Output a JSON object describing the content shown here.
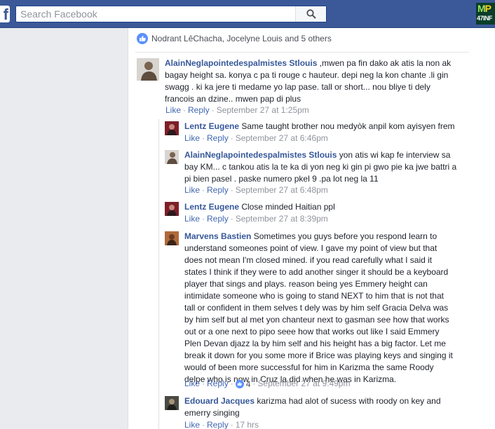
{
  "topbar": {
    "logo_letter": "f",
    "search_placeholder": "Search Facebook",
    "corner_logo_line1_a": "M",
    "corner_logo_line1_b": "P",
    "corner_logo_line2": "47INF"
  },
  "post": {
    "reactions_text": "Nodrant LêChacha, Jocelyne Louis and 5 others"
  },
  "comments": [
    {
      "author": "AlainNeglapointedespalmistes Stlouis",
      "text": " ,mwen pa fin dako ak atis la non ak bagay height sa. konya c pa ti rouge c hauteur. depi neg la kon chante .li gin swagg . ki ka jere ti medame yo lap pase. tall or short... nou bliye ti dely francois an dzine.. mwen pap di plus",
      "like": "Like",
      "reply": "Reply",
      "time": "September 27 at 1:25pm"
    }
  ],
  "replies": [
    {
      "author": "Lentz Eugene",
      "text": " Same taught brother nou medyòk anpil kom ayisyen frem",
      "like": "Like",
      "reply": "Reply",
      "time": "September 27 at 6:46pm"
    },
    {
      "author": "AlainNeglapointedespalmistes Stlouis",
      "text": " yon atis wi kap fe interview sa bay KM... c tankou atis la te ka di yon neg ki gin pi gwo pie ka jwe battri a pi bien pasel . paske numero pkel 9 .pa lot neg la 11",
      "like": "Like",
      "reply": "Reply",
      "time": "September 27 at 6:48pm"
    },
    {
      "author": "Lentz Eugene",
      "text": " Close minded Haitian ppl",
      "like": "Like",
      "reply": "Reply",
      "time": "September 27 at 8:39pm"
    },
    {
      "author": "Marvens Bastien",
      "text": " Sometimes you guys before you respond learn to understand someones point of view. I gave my point of view but that does not mean I'm closed mined. if you read carefully what I said it states I think if they were to add another singer it should be a keyboard player that sings and plays. reason being yes Emmery height can intimidate someone who is going to stand NEXT to him that is not that tall or confident in them selves t dely was by him self Gracia Delva was by him self but al met yon chanteur next to gasman see how that works out or a one next to pipo seee how that works out like I said Emmery Plen Devan djazz la by him self and his height has a big factor. Let me break it down for you some more if Brice was playing keys and singing it would of been more successful for him in Karizma the same Roody delpe who is now in Cruz la did when he was in Karizma.",
      "like": "Like",
      "reply": "Reply",
      "reactions": "4",
      "time": "September 27 at 9:49pm"
    },
    {
      "author": "Edouard Jacques",
      "text": " karizma had alot of sucess with roody on key and emerry singing",
      "like": "Like",
      "reply": "Reply",
      "time": "17 hrs"
    }
  ],
  "colors": {
    "header": "#3b5998",
    "link": "#365899",
    "action_link": "#4267b2",
    "meta": "#90949c",
    "like_blue": "#5890ff"
  }
}
